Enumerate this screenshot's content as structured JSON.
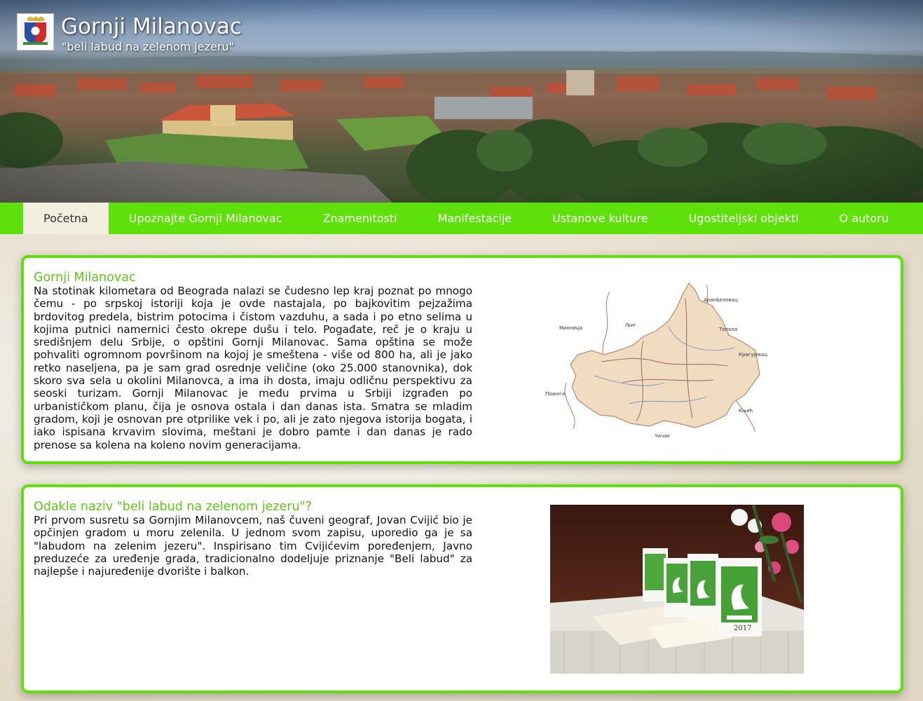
{
  "header": {
    "title": "Gornji Milanovac",
    "subtitle": "\"beli labud na zelenom jezeru\""
  },
  "nav": {
    "items": [
      {
        "label": "Početna",
        "active": true
      },
      {
        "label": "Upoznajte Gornji Milanovac",
        "active": false
      },
      {
        "label": "Znamenitosti",
        "active": false
      },
      {
        "label": "Manifestacije",
        "active": false
      },
      {
        "label": "Ustanove kulture",
        "active": false
      },
      {
        "label": "Ugostiteljski objekti",
        "active": false
      },
      {
        "label": "O autoru",
        "active": false
      }
    ]
  },
  "sections": [
    {
      "title": "Gornji Milanovac",
      "text": "Na stotinak kilometara od Beograda nalazi se čudesno lep kraj poznat po mnogo čemu - po srpskoj istoriji koja je ovde nastajala, po bajkovitim pejzažima brdovitog predela, bistrim potocima i čistom vazduhu, a sada i po etno selima u kojima putnici namernici često okrepe dušu i telo. Pogađate, reč je o kraju u središnjem delu Srbije, o opštini Gornji Milanovac. Sama opština se može pohvaliti ogromnom površinom na kojoj je smeštena - više od 800 ha, ali je jako retko naseljena, pa je sam grad osrednje veličine (oko 25.000 stanovnika), dok skoro sva sela u okolini Milanovca, a ima ih dosta, imaju odličnu perspektivu za seoski turizam. Gornji Milanovac je među prvima u Srbiji izgrađen po urbanističkom planu, čija je osnova ostala i dan danas ista. Smatra se mladim gradom, koji je osnovan pre otprilike vek i po, ali je zato njegova istorija bogata, i iako ispisana krvavim slovima, meštani je dobro pamte i dan danas je rado prenose sa kolena na koleno novim generacijama.",
      "map_labels": [
        "Аранђеловац",
        "Мионица",
        "Љиг",
        "Топола",
        "Крагујевац",
        "Пожега",
        "Књић",
        "Чачак"
      ]
    },
    {
      "title": "Odakle naziv \"beli labud na zelenom jezeru\"?",
      "text": "Pri prvom susretu sa Gornjim Milanovcem, naš čuveni geograf, Jovan Cvijić bio je opčinjen gradom u moru zelenila. U jednom svom zapisu, uporedio ga je sa \"labudom na zelenim jezeru\". Inspirisano tim Cvijićevim poređenjem, Javno preduzeće za uređenje grada, tradicionalno dodeljuje priznanje \"Beli labud\" za najlepše i najuređenije dvorište i balkon.",
      "award_year": "2017"
    }
  ],
  "colors": {
    "accent": "#5ee108",
    "title_green": "#5ec71a",
    "active_tab_bg": "#f3efe0"
  }
}
